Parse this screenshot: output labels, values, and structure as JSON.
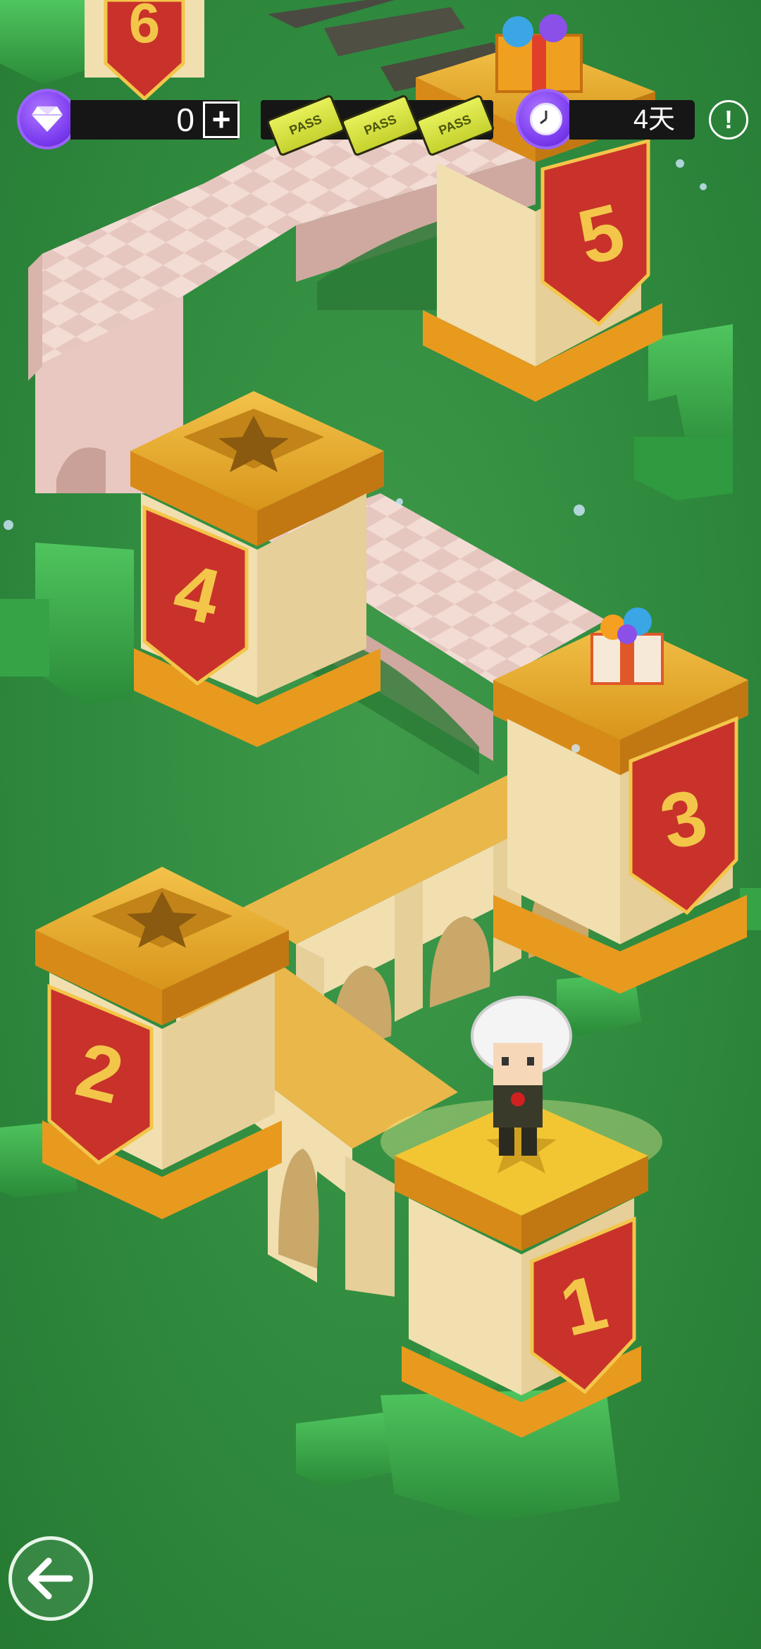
{
  "hud": {
    "gem_icon": "diamond-icon",
    "gem_count": "0",
    "add_label": "+",
    "passes": [
      "PASS",
      "PASS",
      "PASS"
    ],
    "timer_icon": "clock-icon",
    "days_left": "4天",
    "info_label": "!"
  },
  "levels": [
    {
      "number": "1",
      "status": "current",
      "has_character": true
    },
    {
      "number": "2",
      "status": "completed",
      "reward": "star"
    },
    {
      "number": "3",
      "status": "reward",
      "reward": "gift-box"
    },
    {
      "number": "4",
      "status": "completed",
      "reward": "star"
    },
    {
      "number": "5",
      "status": "reward",
      "reward": "gift-box"
    },
    {
      "number": "6",
      "status": "locked"
    }
  ],
  "nav": {
    "back_icon": "arrow-left-icon"
  },
  "colors": {
    "grass": "#2f8a3e",
    "hedge": "#3aa84a",
    "pillar_top": "#e8a920",
    "banner_red": "#c8322a",
    "banner_gold": "#f3c64a",
    "bridge_cream": "#f2dfb0",
    "bridge_pink": "#e8c8c0",
    "hud_purple": "#7d3ef0",
    "ticket_yellow": "#d9e43c"
  }
}
